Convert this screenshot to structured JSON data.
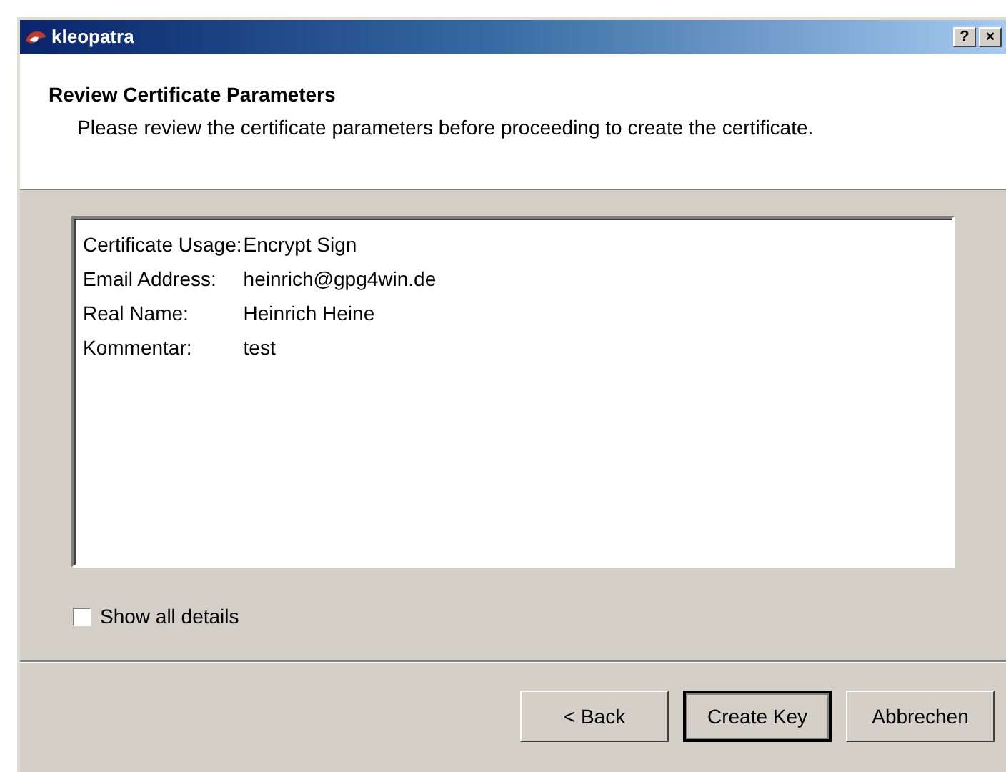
{
  "window": {
    "title": "kleopatra",
    "controls": [
      "?",
      "×"
    ]
  },
  "header": {
    "title": "Review Certificate Parameters",
    "subtitle": "Please review the certificate parameters before proceeding to create the certificate."
  },
  "parameters": [
    {
      "label": "Certificate Usage:",
      "value": "Encrypt Sign"
    },
    {
      "label": "Email Address:",
      "value": "heinrich@gpg4win.de"
    },
    {
      "label": "Real Name:",
      "value": "Heinrich Heine"
    },
    {
      "label": "Kommentar:",
      "value": "test"
    }
  ],
  "show_all_details": {
    "label": "Show all details",
    "checked": false
  },
  "buttons": [
    {
      "label": "< Back",
      "default": false
    },
    {
      "label": "Create Key",
      "default": true
    },
    {
      "label": "Abbrechen",
      "default": false
    }
  ]
}
